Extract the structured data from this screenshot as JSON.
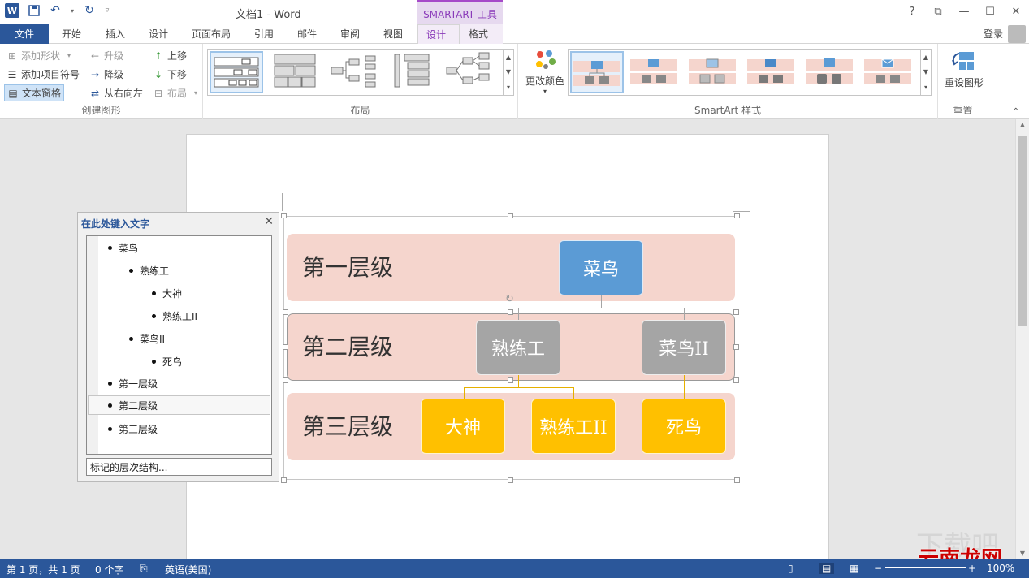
{
  "window": {
    "title": "文档1 - Word",
    "context_tab_header": "SMARTART 工具",
    "controls": [
      "?",
      "⧉",
      "—",
      "☐",
      "✕"
    ]
  },
  "qat": {
    "icons": [
      "word-logo",
      "save-icon",
      "undo-icon",
      "redo-icon",
      "customize-icon"
    ],
    "logo_text": "W"
  },
  "tabs": [
    {
      "label": "文件"
    },
    {
      "label": "开始"
    },
    {
      "label": "插入"
    },
    {
      "label": "设计"
    },
    {
      "label": "页面布局"
    },
    {
      "label": "引用"
    },
    {
      "label": "邮件"
    },
    {
      "label": "审阅"
    },
    {
      "label": "视图"
    },
    {
      "label": "设计"
    },
    {
      "label": "格式"
    }
  ],
  "active_tab": "设计",
  "account": {
    "login": "登录"
  },
  "ribbon": {
    "create_graphic": {
      "label": "创建图形",
      "add_shape": "添加形状",
      "add_bullet": "添加项目符号",
      "text_pane": "文本窗格",
      "promote": "升级",
      "demote": "降级",
      "right_to_left": "从右向左",
      "move_up": "上移",
      "move_down": "下移",
      "layout": "布局"
    },
    "layouts": {
      "label": "布局"
    },
    "styles": {
      "label": "SmartArt 样式",
      "change_colors": "更改颜色"
    },
    "reset": {
      "label": "重置",
      "reset_graphic": "重设图形"
    }
  },
  "text_pane": {
    "title": "在此处键入文字",
    "items": [
      {
        "text": "菜鸟",
        "level": 1
      },
      {
        "text": "熟练工",
        "level": 2
      },
      {
        "text": "大神",
        "level": 3
      },
      {
        "text": "熟练工II",
        "level": 3
      },
      {
        "text": "菜鸟II",
        "level": 2
      },
      {
        "text": "死鸟",
        "level": 3
      },
      {
        "text": "第一层级",
        "level": 1
      },
      {
        "text": "第二层级",
        "level": 1,
        "selected": true
      },
      {
        "text": "第三层级",
        "level": 1
      }
    ],
    "footer": "标记的层次结构..."
  },
  "smartart": {
    "bands": [
      "第一层级",
      "第二层级",
      "第三层级"
    ],
    "nodes": {
      "root": "菜鸟",
      "level2_a": "熟练工",
      "level2_b": "菜鸟II",
      "level3_a": "大神",
      "level3_b": "熟练工II",
      "level3_c": "死鸟"
    },
    "colors": {
      "band": "#f5d5cd",
      "level1": "#5b9bd5",
      "level2": "#a5a5a5",
      "level3": "#ffc000"
    }
  },
  "status": {
    "page": "第 1 页，共 1 页",
    "words": "0 个字",
    "language": "英语(美国)",
    "zoom": "100%"
  },
  "watermark": {
    "text": "云南龙网"
  }
}
